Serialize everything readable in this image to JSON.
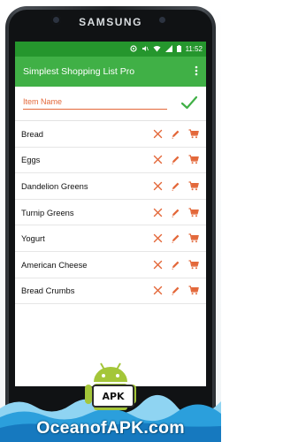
{
  "device": {
    "brand": "SAMSUNG"
  },
  "status_bar": {
    "time": "11:52"
  },
  "app_bar": {
    "title": "Simplest Shopping List Pro"
  },
  "input": {
    "placeholder": "Item Name",
    "value": ""
  },
  "items": [
    {
      "label": "Bread"
    },
    {
      "label": "Eggs"
    },
    {
      "label": "Dandelion Greens"
    },
    {
      "label": "Turnip Greens"
    },
    {
      "label": "Yogurt"
    },
    {
      "label": "American Cheese"
    },
    {
      "label": "Bread Crumbs"
    }
  ],
  "icons": {
    "delete": "close-icon",
    "edit": "pencil-icon",
    "cart": "cart-icon",
    "add": "check-icon"
  },
  "colors": {
    "status_bar": "#25962d",
    "app_bar": "#40b046",
    "accent": "#e3683a",
    "check": "#40b046"
  },
  "watermark": {
    "badge": "APK",
    "text": "OceanofAPK.com"
  }
}
